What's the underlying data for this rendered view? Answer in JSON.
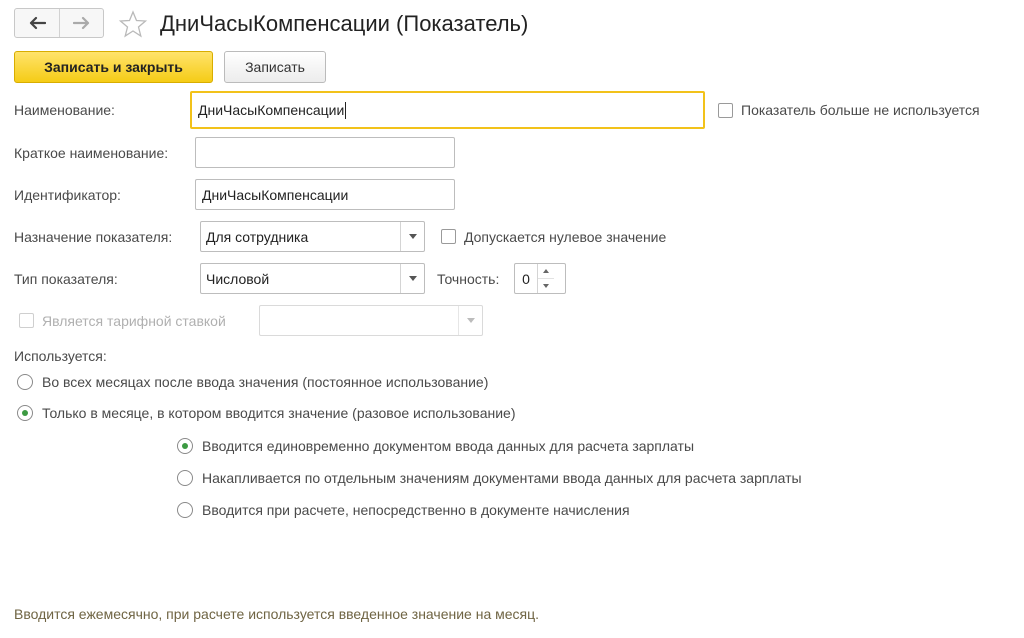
{
  "window": {
    "title": "ДниЧасыКомпенсации (Показатель)",
    "nav_back_icon": "arrow-left-icon",
    "nav_forward_icon": "arrow-right-icon",
    "favorite_icon": "star-icon"
  },
  "toolbar": {
    "save_close_label": "Записать и закрыть",
    "save_label": "Записать"
  },
  "form": {
    "name_label": "Наименование:",
    "name_value": "ДниЧасыКомпенсации",
    "not_used_label": "Показатель больше не используется",
    "short_name_label": "Краткое наименование:",
    "short_name_value": "",
    "identifier_label": "Идентификатор:",
    "identifier_value": "ДниЧасыКомпенсации",
    "purpose_label": "Назначение показателя:",
    "purpose_value": "Для сотрудника",
    "zero_allowed_label": "Допускается нулевое значение",
    "type_label": "Тип показателя:",
    "type_value": "Числовой",
    "precision_label": "Точность:",
    "precision_value": "0",
    "tariff_label": "Является тарифной ставкой",
    "tariff_value": ""
  },
  "usage": {
    "label": "Используется:",
    "options": [
      {
        "label": "Во всех месяцах после ввода значения (постоянное использование)",
        "selected": false
      },
      {
        "label": "Только в месяце, в котором вводится значение (разовое использование)",
        "selected": true
      }
    ],
    "sub_options": [
      {
        "label": "Вводится единовременно документом ввода данных для расчета зарплаты",
        "selected": true
      },
      {
        "label": "Накапливается по отдельным значениям документами ввода данных для расчета зарплаты",
        "selected": false
      },
      {
        "label": "Вводится при расчете, непосредственно в документе начисления",
        "selected": false
      }
    ]
  },
  "footer": {
    "note": "Вводится ежемесячно, при расчете используется введенное значение на месяц."
  },
  "colors": {
    "accent_yellow": "#f5cc16",
    "focus_border": "#f2c21a",
    "radio_selected": "#3c9a42",
    "footer_text": "#6f6443"
  }
}
